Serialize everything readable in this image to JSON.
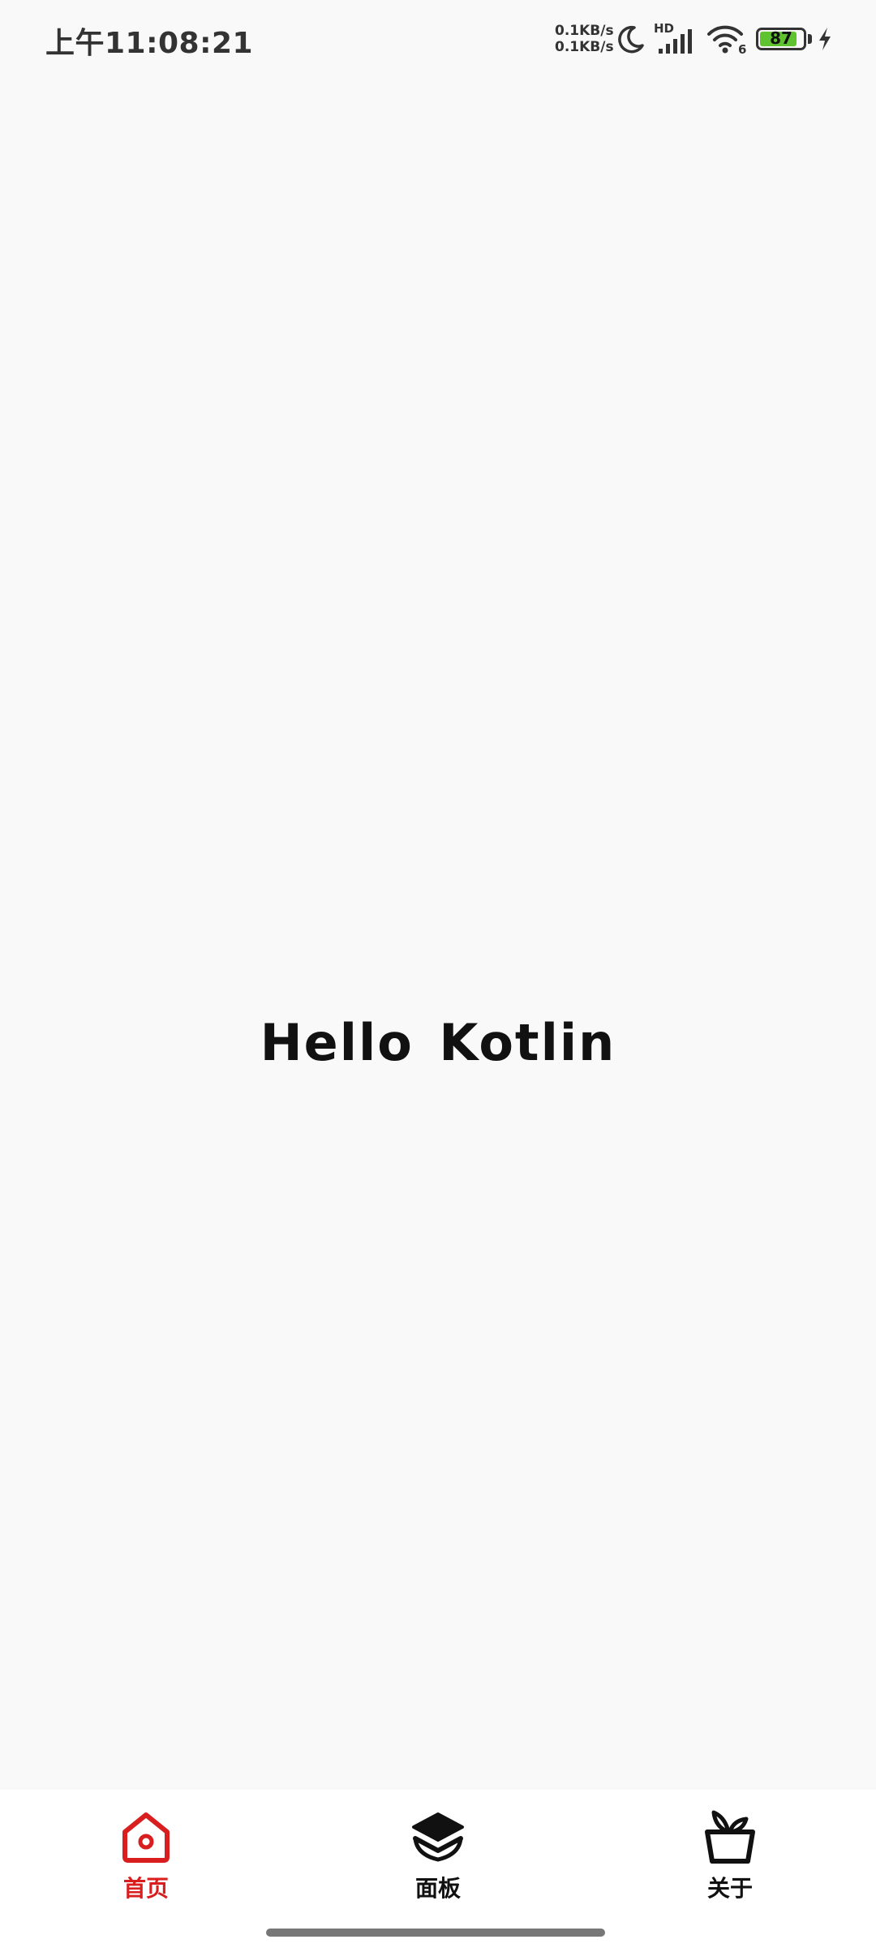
{
  "status_bar": {
    "time": "上午11:08:21",
    "net_speed_up": "0.1KB/s",
    "net_speed_down": "0.1KB/s",
    "hd_label": "HD",
    "wifi_label": "6",
    "battery_level": "87",
    "battery_color": "#5ec32f",
    "icons": [
      "moon-icon",
      "signal-icon",
      "wifi-icon",
      "battery-icon",
      "charging-icon"
    ]
  },
  "main": {
    "greeting": "Hello Kotlin"
  },
  "bottom_nav": {
    "active_color": "#d81e1e",
    "items": [
      {
        "label": "首页",
        "icon": "home-icon",
        "active": true
      },
      {
        "label": "面板",
        "icon": "layers-icon",
        "active": false
      },
      {
        "label": "关于",
        "icon": "plant-pot-icon",
        "active": false
      }
    ]
  }
}
